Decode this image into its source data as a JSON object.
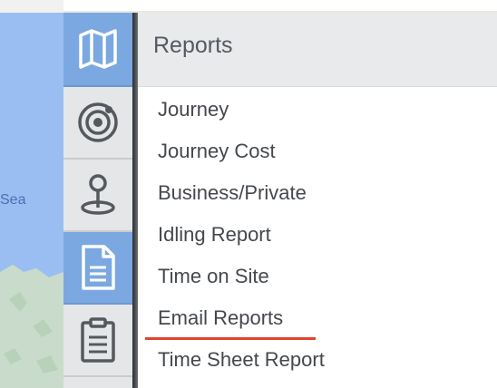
{
  "map": {
    "sea_label": "Sea",
    "colors": {
      "water": "#9bbef2",
      "land": "#c9dccb"
    }
  },
  "rail": {
    "items": [
      {
        "icon": "map-icon",
        "active": true
      },
      {
        "icon": "target-icon",
        "active": false
      },
      {
        "icon": "location-pin-icon",
        "active": false
      },
      {
        "icon": "document-icon",
        "active": true
      },
      {
        "icon": "clipboard-icon",
        "active": false
      }
    ]
  },
  "panel": {
    "title": "Reports",
    "items": [
      {
        "label": "Journey"
      },
      {
        "label": "Journey Cost"
      },
      {
        "label": "Business/Private"
      },
      {
        "label": "Idling Report"
      },
      {
        "label": "Time on Site"
      },
      {
        "label": "Email Reports",
        "highlighted": true
      },
      {
        "label": "Time Sheet Report"
      }
    ],
    "highlight_color": "#e2432e"
  }
}
